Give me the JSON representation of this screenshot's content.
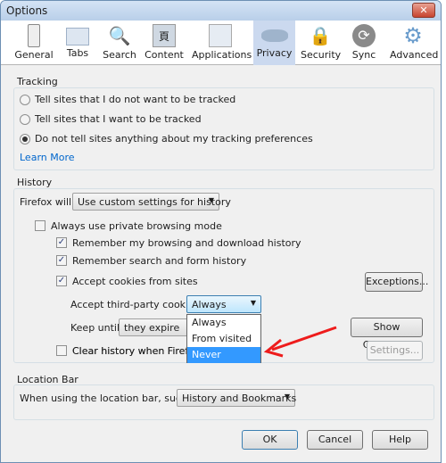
{
  "window": {
    "title": "Options",
    "close_icon": "close-icon"
  },
  "toolbar": {
    "tabs": [
      {
        "label": "General",
        "icon": "switch-icon"
      },
      {
        "label": "Tabs",
        "icon": "folder-tabs-icon"
      },
      {
        "label": "Search",
        "icon": "magnifier-icon"
      },
      {
        "label": "Content",
        "icon": "content-images-icon"
      },
      {
        "label": "Applications",
        "icon": "applications-icon"
      },
      {
        "label": "Privacy",
        "icon": "mask-icon",
        "selected": true
      },
      {
        "label": "Security",
        "icon": "padlock-icon"
      },
      {
        "label": "Sync",
        "icon": "sync-icon"
      },
      {
        "label": "Advanced",
        "icon": "gear-icon"
      }
    ]
  },
  "tracking": {
    "label": "Tracking",
    "options": [
      "Tell sites that I do not want to be tracked",
      "Tell sites that I want to be tracked",
      "Do not tell sites anything about my tracking preferences"
    ],
    "selected": 2,
    "learn_more": "Learn More"
  },
  "history": {
    "label": "History",
    "firefox_will": "Firefox will:",
    "mode": "Use custom settings for history",
    "private": "Always use private browsing mode",
    "remember_browsing": "Remember my browsing and download history",
    "remember_search": "Remember search and form history",
    "accept_cookies": "Accept cookies from sites",
    "exceptions": "Exceptions...",
    "third_party_label": "Accept third-party cookies:",
    "third_party_value": "Always",
    "third_party_options": [
      "Always",
      "From visited",
      "Never"
    ],
    "highlighted_option": "Never",
    "keep_until_label": "Keep until:",
    "keep_until_value": "they expire",
    "show_cookies": "Show Cookies...",
    "clear_history": "Clear history when Firefox closes",
    "clear_history_visible": "Clear history when Firefox clo",
    "settings": "Settings..."
  },
  "location_bar": {
    "label": "Location Bar",
    "suggest_label": "When using the location bar, suggest:",
    "suggest_value": "History and Bookmarks"
  },
  "footer": {
    "ok": "OK",
    "cancel": "Cancel",
    "help": "Help"
  },
  "colors": {
    "highlight": "#3399ff",
    "arrow": "#ee1c1c",
    "link": "#0066cc"
  }
}
